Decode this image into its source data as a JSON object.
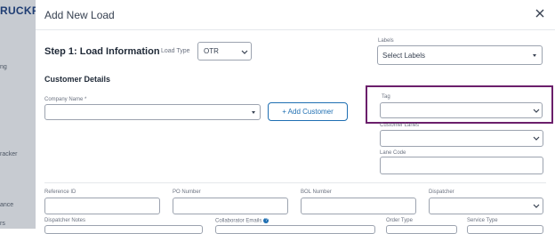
{
  "background": {
    "brand_fragment": "RUCKPI",
    "nav_fragments": [
      "ng",
      "racker",
      "ance",
      "rs"
    ]
  },
  "modal": {
    "title": "Add New Load",
    "close_icon": "close-icon",
    "step_title": "Step 1: Load Information",
    "load_type_label": "Load Type",
    "load_type_value": "OTR",
    "labels_label": "Labels",
    "labels_placeholder": "Select Labels",
    "customer_details_title": "Customer Details",
    "company_name_label": "Company Name *",
    "add_customer_label": "+ Add Customer",
    "tag_label": "Tag",
    "customer_lanes_label": "Customer Lanes",
    "lane_code_label": "Lane Code",
    "reference_id_label": "Reference ID",
    "po_number_label": "PO Number",
    "bol_number_label": "BOL Number",
    "dispatcher_label": "Dispatcher",
    "dispatcher_notes_label": "Dispatcher Notes",
    "collaborator_emails_label": "Collaborator Emails",
    "order_type_label": "Order Type",
    "service_type_label": "Service Type"
  },
  "colors": {
    "accent": "#1f6fb2",
    "highlight": "#6b1f6b",
    "backdrop": "#c7cbd1"
  }
}
